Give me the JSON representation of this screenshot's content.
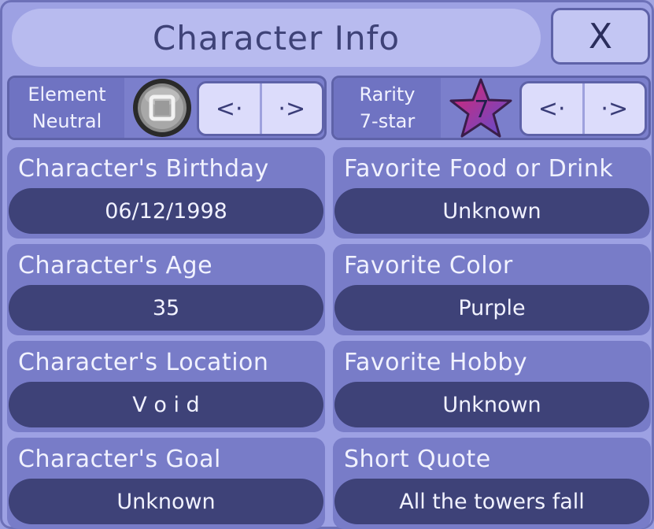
{
  "window": {
    "title": "Character Info",
    "close_label": "X"
  },
  "element": {
    "label": "Element",
    "value": "Neutral",
    "prev_label": "<·",
    "next_label": "·>"
  },
  "rarity": {
    "label": "Rarity",
    "value": "7-star",
    "badge": "7",
    "prev_label": "<·",
    "next_label": "·>"
  },
  "fields": [
    {
      "label": "Character's Birthday",
      "value": "06/12/1998"
    },
    {
      "label": "Favorite Food or Drink",
      "value": "Unknown"
    },
    {
      "label": "Character's Age",
      "value": "35"
    },
    {
      "label": "Favorite Color",
      "value": "Purple"
    },
    {
      "label": "Character's Location",
      "value": "V o i d"
    },
    {
      "label": "Favorite Hobby",
      "value": "Unknown"
    },
    {
      "label": "Character's Goal",
      "value": "Unknown"
    },
    {
      "label": "Short Quote",
      "value": "All the towers fall"
    }
  ],
  "colors": {
    "panel": "#9da1e3",
    "card": "#787cc8",
    "value_pill": "#3e4278",
    "star_from": "#e0226c",
    "star_to": "#5a4fd4"
  },
  "icons": {
    "element": "neutral-element-orb-icon",
    "rarity": "star-icon"
  }
}
